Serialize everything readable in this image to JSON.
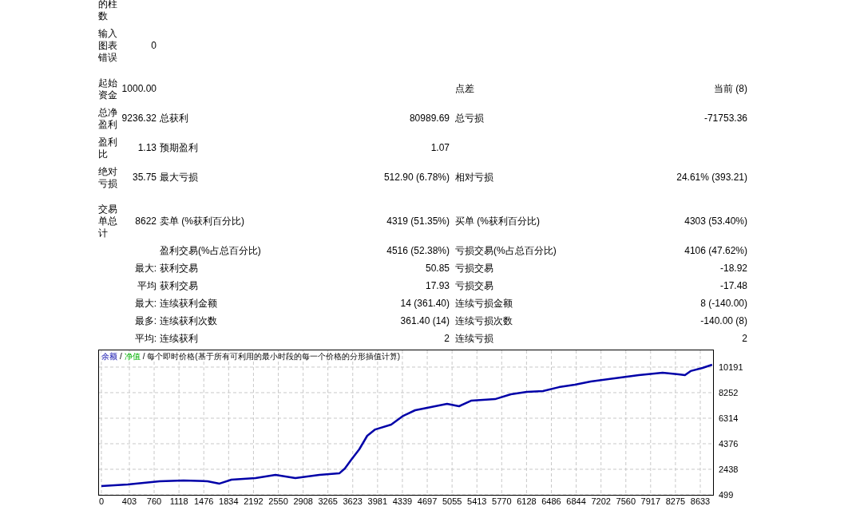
{
  "sections": [
    [
      {
        "c1": "的柱数"
      },
      {
        "c1": "输入图表错误",
        "c2": "0"
      }
    ],
    [
      {
        "c1": "起始资金",
        "c2": "1000.00",
        "c5": "点差",
        "c6": "当前 (8)"
      },
      {
        "c1": "总净盈利",
        "c2": "9236.32",
        "c3": "总获利",
        "c4": "80989.69",
        "c5": "总亏损",
        "c6": "-71753.36"
      },
      {
        "c1": "盈利比",
        "c2": "1.13",
        "c3": "预期盈利",
        "c4": "1.07"
      },
      {
        "c1": "绝对亏损",
        "c2": "35.75",
        "c3": "最大亏损",
        "c4": "512.90 (6.78%)",
        "c5": "相对亏损",
        "c6": "24.61% (393.21)"
      }
    ],
    [
      {
        "c1": "交易单总计",
        "c2": "8622",
        "c3": "卖单 (%获利百分比)",
        "c4": "4319 (51.35%)",
        "c5": "买单 (%获利百分比)",
        "c6": "4303 (53.40%)"
      },
      {
        "c3": "盈利交易(%占总百分比)",
        "c4": "4516 (52.38%)",
        "c5": "亏损交易(%占总百分比)",
        "c6": "4106 (47.62%)"
      },
      {
        "c2": "最大:",
        "c3": "获利交易",
        "c4": "50.85",
        "c5": "亏损交易",
        "c6": "-18.92"
      },
      {
        "c2": "平均",
        "c3": "获利交易",
        "c4": "17.93",
        "c5": "亏损交易",
        "c6": "-17.48"
      },
      {
        "c2": "最大:",
        "c3": "连续获利金额",
        "c4": "14 (361.40)",
        "c5": "连续亏损金额",
        "c6": "8 (-140.00)"
      },
      {
        "c2": "最多:",
        "c3": "连续获利次数",
        "c4": "361.40 (14)",
        "c5": "连续亏损次数",
        "c6": "-140.00 (8)"
      },
      {
        "c2": "平均:",
        "c3": "连续获利",
        "c4": "2",
        "c5": "连续亏损",
        "c6": "2"
      }
    ]
  ],
  "chart": {
    "legend_items": [
      {
        "kind": "separator",
        "text": "/"
      },
      {
        "kind": "equity",
        "text": "净值"
      },
      {
        "kind": "note",
        "text": "/ 每个即时价格(基于所有可利用的最小时段的每一个价格的分形插值计算)"
      }
    ],
    "chart_data": {
      "type": "line",
      "grid": true,
      "xlim": [
        -46,
        8817
      ],
      "ylim": [
        499,
        11521
      ],
      "xticks": [
        0,
        403,
        760,
        1118,
        1476,
        1834,
        2192,
        2550,
        2908,
        3265,
        3623,
        3981,
        4339,
        4697,
        5055,
        5413,
        5770,
        6128,
        6486,
        6844,
        7202,
        7560,
        7917,
        8275,
        8633
      ],
      "yticks": [
        499,
        2438,
        4376,
        6314,
        8252,
        10191
      ],
      "x": [
        0,
        380,
        840,
        1185,
        1530,
        1703,
        1875,
        2221,
        2509,
        2796,
        3142,
        3429,
        3510,
        3602,
        3717,
        3832,
        3947,
        4177,
        4350,
        4522,
        4753,
        4983,
        5155,
        5328,
        5673,
        5903,
        6133,
        6364,
        6594,
        6824,
        7054,
        7399,
        7745,
        8090,
        8320,
        8412,
        8493,
        8665,
        8803
      ],
      "series": [
        {
          "name": "余额",
          "color": "#0000a8",
          "values": [
            1170,
            1290,
            1530,
            1590,
            1530,
            1350,
            1650,
            1770,
            2010,
            1770,
            2010,
            2130,
            2500,
            3160,
            3950,
            4980,
            5460,
            5830,
            6490,
            6920,
            7160,
            7400,
            7220,
            7640,
            7760,
            8130,
            8310,
            8370,
            8670,
            8860,
            9100,
            9340,
            9580,
            9770,
            9650,
            9580,
            9890,
            10130,
            10370
          ]
        }
      ]
    }
  }
}
